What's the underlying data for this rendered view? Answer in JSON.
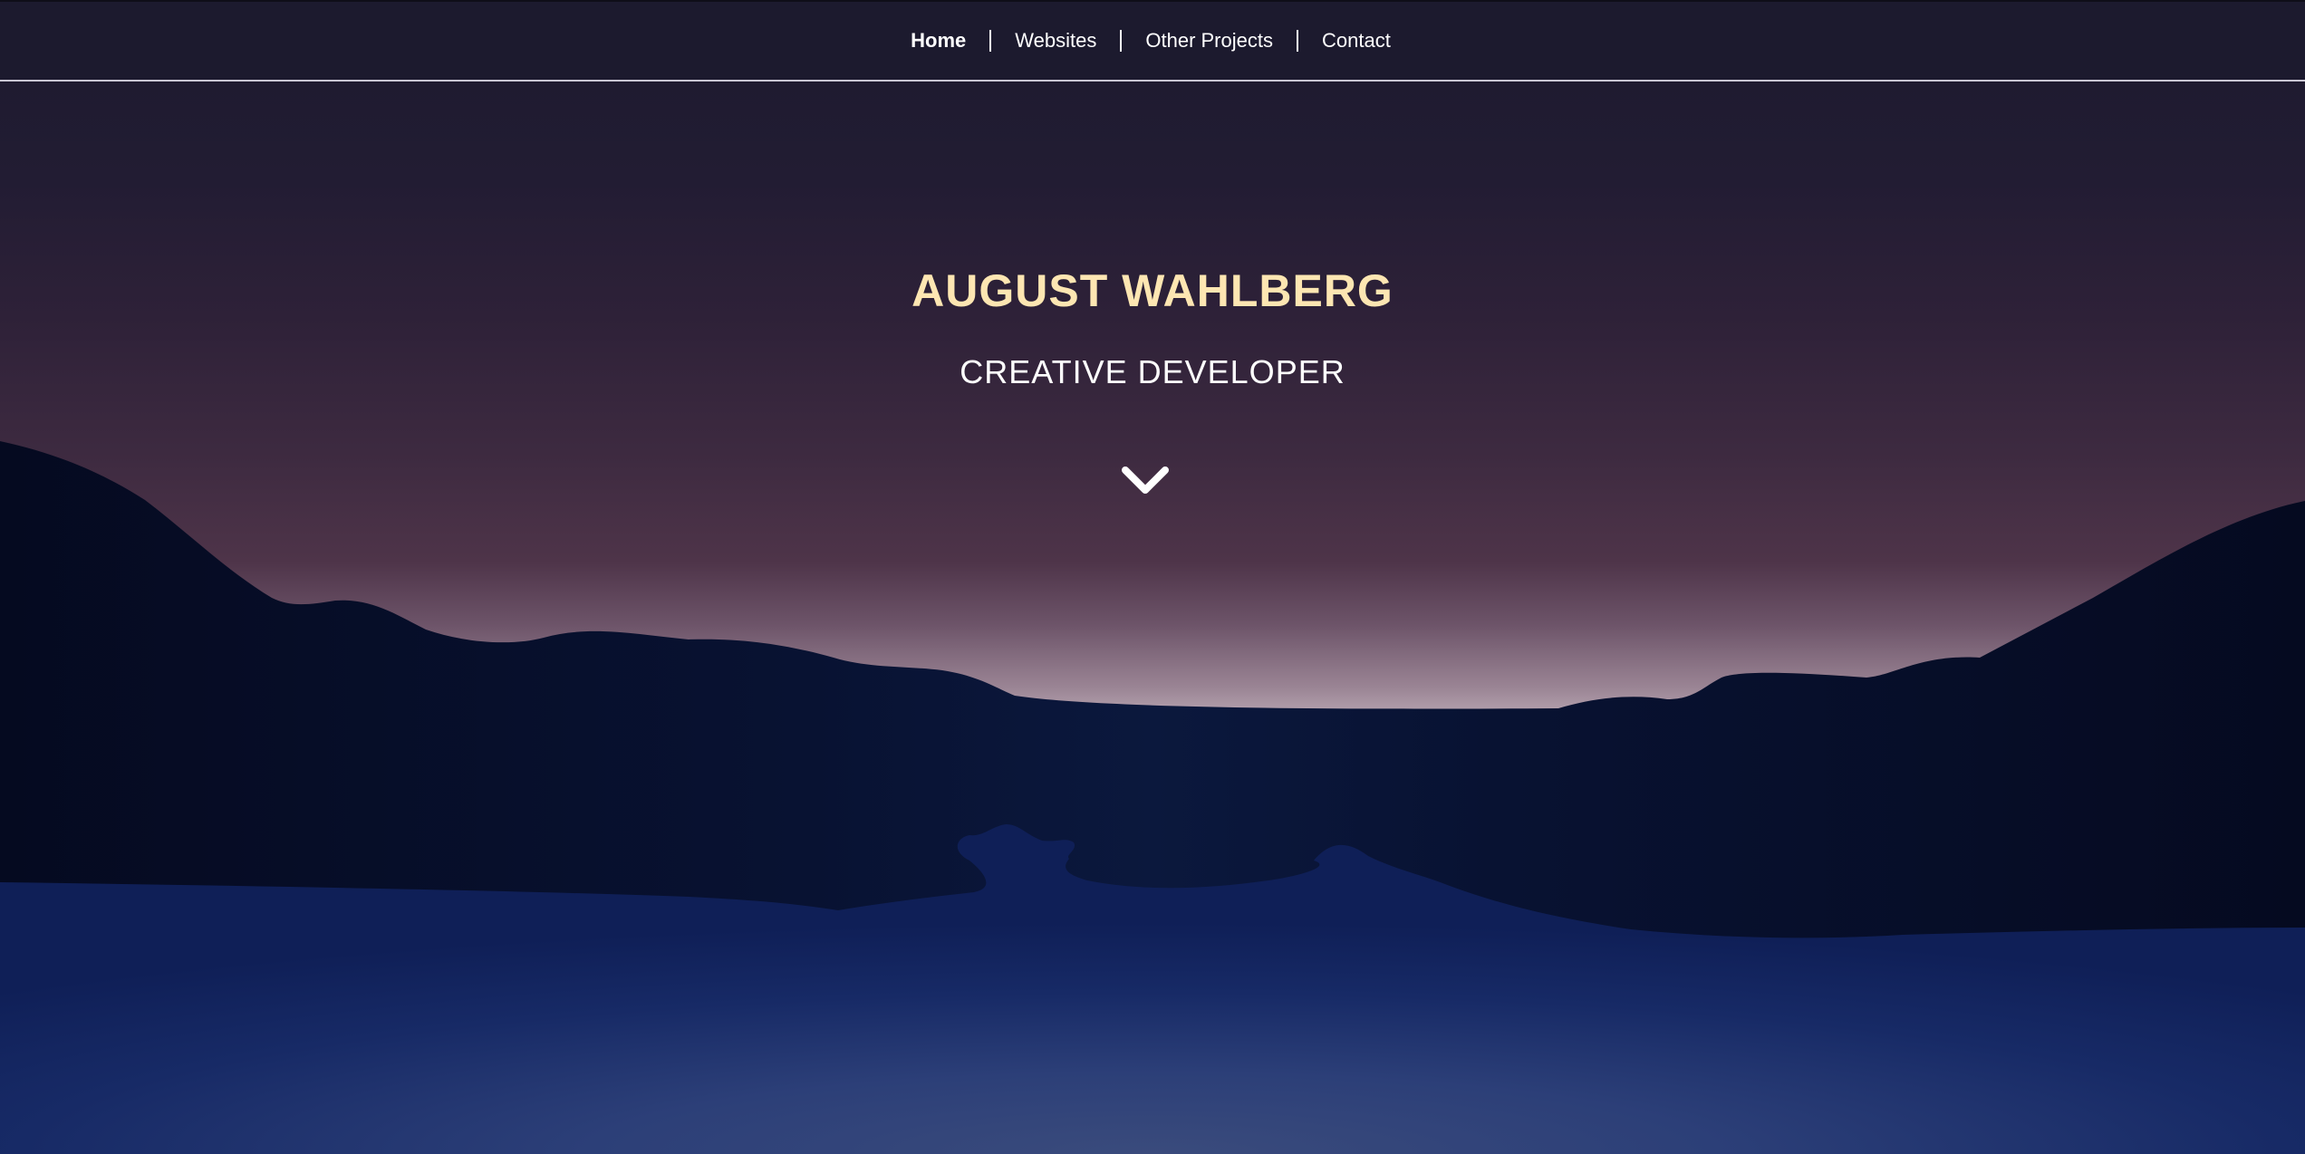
{
  "nav": {
    "items": [
      {
        "label": "Home",
        "active": true
      },
      {
        "label": "Websites",
        "active": false
      },
      {
        "label": "Other Projects",
        "active": false
      },
      {
        "label": "Contact",
        "active": false
      }
    ]
  },
  "hero": {
    "name": "AUGUST WAHLBERG",
    "role": "CREATIVE DEVELOPER",
    "scroll_icon": "chevron-down-icon"
  },
  "colors": {
    "nav_background": "#1c1a2e",
    "name_color": "#fde6b2",
    "text_color": "#ffffff",
    "mountain_dark": "#070b22",
    "lake_blue": "#1a2a63"
  }
}
